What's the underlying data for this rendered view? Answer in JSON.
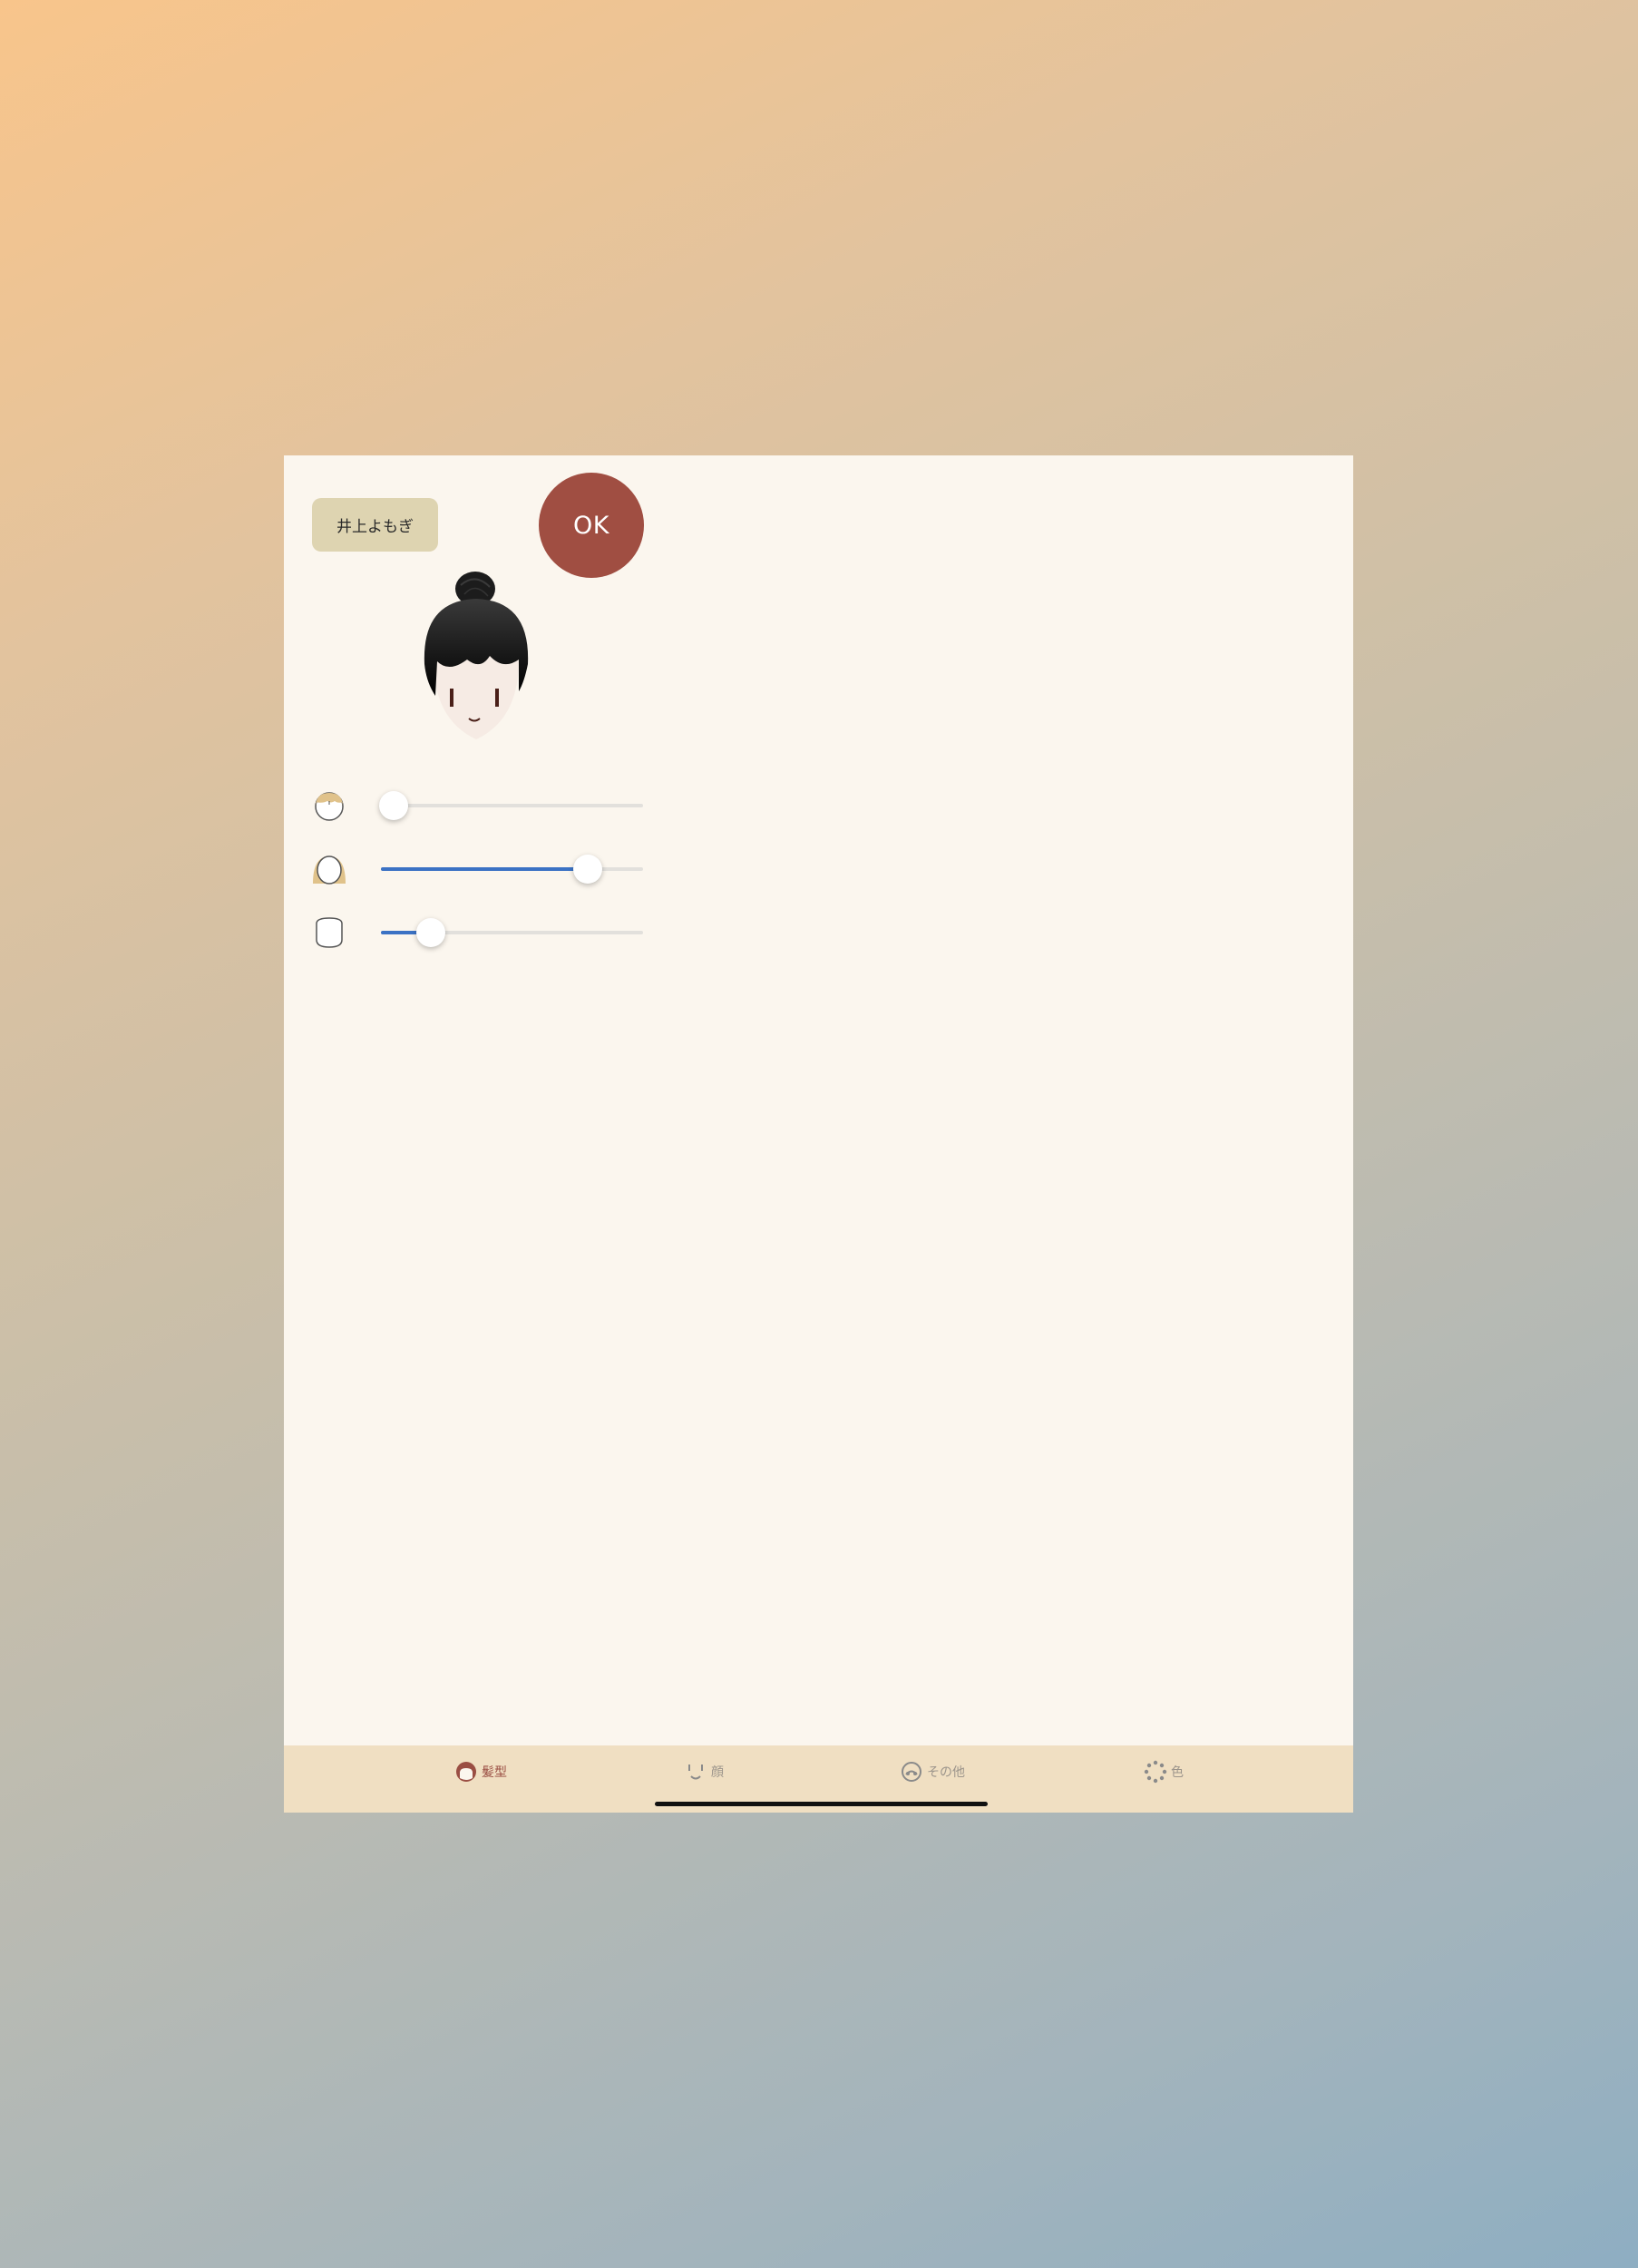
{
  "header": {
    "name_label": "井上よもぎ",
    "ok_label": "OK"
  },
  "sliders": [
    {
      "name": "bangs",
      "icon": "bangs-hair-icon",
      "value": 0.05
    },
    {
      "name": "length",
      "icon": "long-hair-icon",
      "value": 0.79
    },
    {
      "name": "volume",
      "icon": "face-outline-icon",
      "value": 0.19
    }
  ],
  "tabs": [
    {
      "label": "髪型",
      "icon": "hair-icon",
      "active": true
    },
    {
      "label": "顔",
      "icon": "face-icon",
      "active": false
    },
    {
      "label": "その他",
      "icon": "accessory-icon",
      "active": false
    },
    {
      "label": "色",
      "icon": "color-palette-icon",
      "active": false
    }
  ],
  "colors": {
    "accent": "#a04e42",
    "slider_fill": "#3b72c4",
    "tab_bar": "#f0dfc2",
    "name_tag": "#ded4b1",
    "panel": "#fbf6ee"
  }
}
